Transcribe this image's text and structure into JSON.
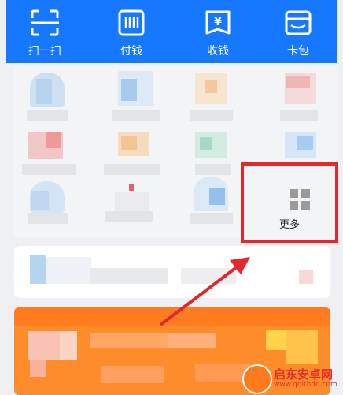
{
  "topbar": {
    "items": [
      {
        "label": "扫一扫",
        "icon": "scan-icon"
      },
      {
        "label": "付钱",
        "icon": "pay-icon"
      },
      {
        "label": "收钱",
        "icon": "receive-money-icon"
      },
      {
        "label": "卡包",
        "icon": "card-wallet-icon"
      }
    ]
  },
  "more": {
    "label": "更多",
    "icon": "grid-icon"
  },
  "watermark": {
    "title": "启东安卓网",
    "url": "www.qdlthdq.com"
  },
  "colors": {
    "brand_blue": "#1677ff",
    "highlight_red": "#e5262b",
    "promo_orange": "#ff8c2a"
  }
}
